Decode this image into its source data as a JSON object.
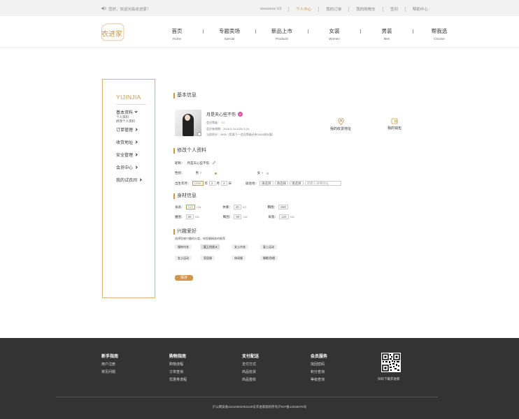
{
  "topbar": {
    "welcome": "您好，欢迎光临衣进家！",
    "links": [
      "xxxxxxxx V3",
      "个人中心",
      "我的订单",
      "我的购物车",
      "签到",
      "帮助中心"
    ]
  },
  "logo": {
    "text": "衣进家"
  },
  "nav": [
    {
      "zh": "首页",
      "en": "Home"
    },
    {
      "zh": "专题卖场",
      "en": "Special"
    },
    {
      "zh": "新品上市",
      "en": "Products"
    },
    {
      "zh": "女装",
      "en": "Women"
    },
    {
      "zh": "男装",
      "en": "Men"
    },
    {
      "zh": "帮我选",
      "en": "Choose"
    }
  ],
  "sidebar": {
    "brand": "YIJINJIA",
    "items": [
      {
        "label": "基本资料",
        "subs": [
          "个人资料",
          "修改个人资料"
        ]
      },
      {
        "label": "订单管理"
      },
      {
        "label": "收货地址"
      },
      {
        "label": "安全管理"
      },
      {
        "label": "会员中心"
      },
      {
        "label": "我的试衣间"
      }
    ]
  },
  "basic": {
    "title": "基本信息",
    "nickname": "月是天心些不伤",
    "vip_badge": "V",
    "level_label": "会员等级：",
    "level_value": "V3",
    "valid": "会员有效期：2018.3.24-2020.3.24",
    "points": "当前积分：3600（距离下一会员等级还有1400成长值）",
    "address_link": "我的收货地址",
    "wallet_link": "我的钱包"
  },
  "edit": {
    "title": "修改个人资料",
    "nick_label": "昵称：",
    "nick_value": "月是天心些不伤",
    "gender_label": "性别：",
    "male": "男 ♂",
    "female": "女 ♀",
    "birth_label": "出生年月：",
    "birth_year": "1999",
    "year_unit": "年",
    "birth_month": "2",
    "month_unit": "月",
    "birth_day": "2",
    "day_unit": "日",
    "addr_label": "居住地：",
    "province": "请选择",
    "city": "请选择",
    "district": "请选择",
    "detail_placeholder": "请输入详细地址"
  },
  "body": {
    "title": "身材信息",
    "height_label": "身高：",
    "height_value": "162",
    "height_unit": "CM",
    "weight_label": "体重：",
    "weight_value": "40",
    "weight_unit": "KG",
    "bust_label": "胸围：",
    "bust_value": "36D",
    "waist_label": "腰围：",
    "waist_value": "60",
    "waist_unit": "CM",
    "hip_label": "臀围：",
    "hip_value": "90",
    "hip_unit": "CM",
    "shoulder_label": "肩宽：",
    "shoulder_value": "120",
    "shoulder_unit": "CM"
  },
  "hobby": {
    "title": "兴趣爱好",
    "hint": "选择您感兴趣的分类，给您最精准的推荐",
    "tags": [
      "服饰内衣",
      "爱上内衣 ▾",
      "女士内衣",
      "爱上运动",
      "女士运动",
      "家居服",
      "休闲服",
      "睡眠/防晒"
    ],
    "save": "保存"
  },
  "footer": {
    "cols": [
      {
        "h": "新手指南",
        "items": [
          "用户注册",
          "常见问题"
        ]
      },
      {
        "h": "购物指南",
        "items": [
          "购物流程",
          "订单查询",
          "优惠劵流程"
        ]
      },
      {
        "h": "支付配送",
        "items": [
          "支付方式",
          "商品检货",
          "商品签收"
        ]
      },
      {
        "h": "会员服务",
        "items": [
          "找回密码",
          "积分查询",
          "等级查询"
        ]
      }
    ],
    "qr_caption": "扫码下载衣进家",
    "copyright": "沪公网安备31010502004130号衣进家版权所有沪ICP备14035076号"
  }
}
